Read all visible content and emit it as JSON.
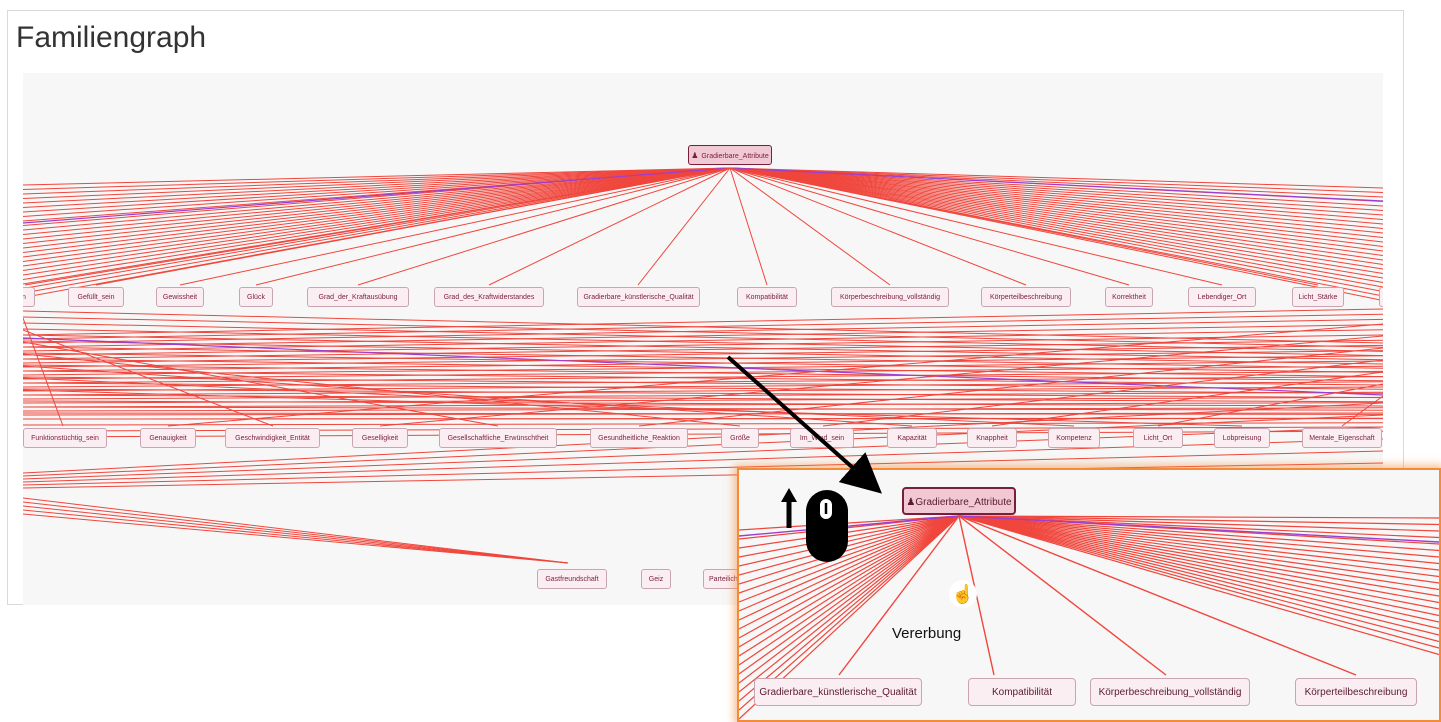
{
  "panel": {
    "title": "Familiengraph"
  },
  "root": {
    "label": "Gradierbare_Attribute",
    "icon": "users-icon"
  },
  "row1": [
    "n",
    "Gefüllt_sein",
    "Gewissheit",
    "Glück",
    "Grad_der_Kraftausübung",
    "Grad_des_Kraftwiderstandes",
    "Gradierbare_künstlerische_Qualität",
    "Kompatibilität",
    "Körperbeschreibung_vollständig",
    "Körperteilbeschreibung",
    "Korrektheit",
    "Lebendiger_Ort",
    "Licht_Stärke"
  ],
  "row2": [
    "Funktionstüchtig_sein",
    "Genauigkeit",
    "Geschwindigkeit_Entität",
    "Geselligkeit",
    "Gesellschaftliche_Erwünschtheit",
    "Gesundheitliche_Reaktion",
    "Größe",
    "Im_Wind_sein",
    "Kapazität",
    "Knappheit",
    "Kompetenz",
    "Licht_Ort",
    "Lobpreisung",
    "Mentale_Eigenschaft"
  ],
  "row3": [
    "Gastfreundschaft",
    "Geiz",
    "Parteilichkeit"
  ],
  "zoom": {
    "root_label": "Gradierbare_Attribute",
    "children": [
      "Gradierbare_künstlerische_Qualität",
      "Kompatibilität",
      "Körperbeschreibung_vollständig",
      "Körperteilbeschreibung"
    ],
    "edge_label": "Vererbung"
  },
  "colors": {
    "edge": "#f0463c",
    "edge_highlight": "#9b3fd0",
    "callout": "#f28c38",
    "node_text": "#7a1f3a"
  }
}
